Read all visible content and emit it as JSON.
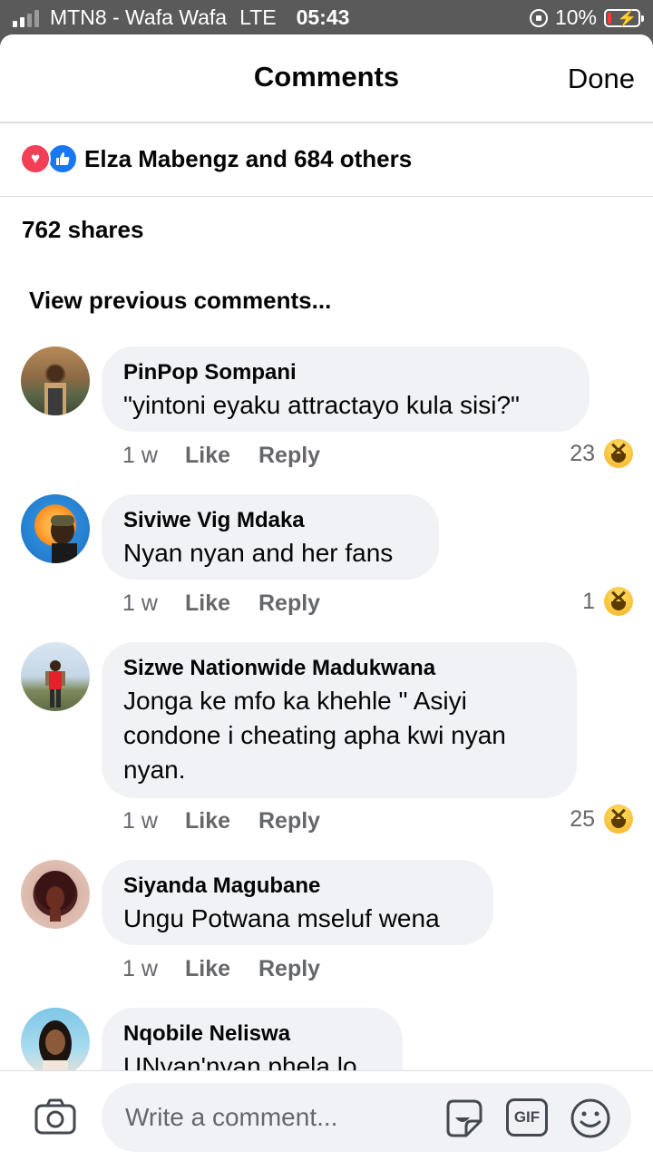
{
  "status_bar": {
    "carrier": "MTN8 - Wafa Wafa",
    "network": "LTE",
    "time": "05:43",
    "battery": "10%",
    "battery_level_percent": 10
  },
  "header": {
    "title": "Comments",
    "done_label": "Done"
  },
  "reactions": {
    "text": "Elza Mabengz and 684 others",
    "icons": [
      "heart-icon",
      "like-icon"
    ]
  },
  "shares": "762 shares",
  "view_previous": "View previous comments...",
  "comments": [
    {
      "name": "PinPop Sompani",
      "body": "\"yintoni eyaku attractayo kula sisi?\"",
      "time": "1 w",
      "like": "Like",
      "reply": "Reply",
      "reaction_count": "23"
    },
    {
      "name": "Siviwe Vig Mdaka",
      "body": "Nyan nyan and her fans",
      "time": "1 w",
      "like": "Like",
      "reply": "Reply",
      "reaction_count": "1"
    },
    {
      "name": "Sizwe Nationwide Madukwana",
      "body": "Jonga ke mfo ka khehle \" Asiyi condone  i cheating apha kwi nyan nyan.",
      "time": "1 w",
      "like": "Like",
      "reply": "Reply",
      "reaction_count": "25"
    },
    {
      "name": "Siyanda Magubane",
      "body": "Ungu Potwana mseluf wena",
      "time": "1 w",
      "like": "Like",
      "reply": "Reply"
    },
    {
      "name": "Nqobile Neliswa",
      "body": "UNyan'nyan phela lo"
    }
  ],
  "composer": {
    "placeholder": "Write a comment...",
    "gif_label": "GIF"
  },
  "colors": {
    "bubble": "#f0f2f5",
    "accent_like": "#1877f2",
    "accent_heart": "#f33e58",
    "meta_text": "#65676b"
  }
}
